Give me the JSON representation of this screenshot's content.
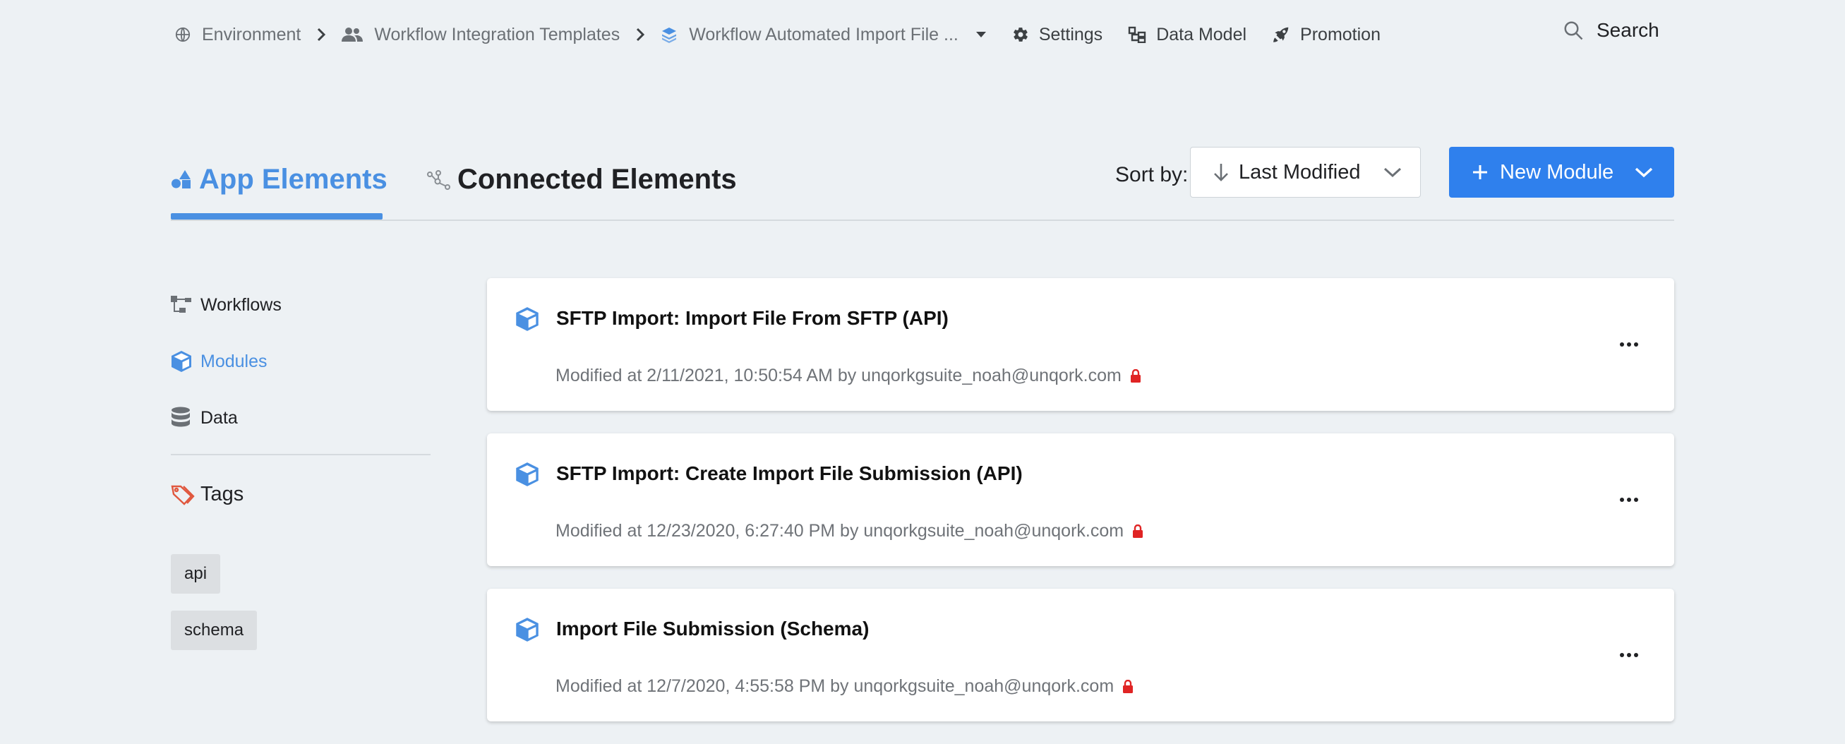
{
  "breadcrumb": {
    "environment": "Environment",
    "workspace": "Workflow Integration Templates",
    "app": "Workflow Automated Import File ..."
  },
  "nav": {
    "settings": "Settings",
    "data_model": "Data Model",
    "promotion": "Promotion",
    "search": "Search"
  },
  "tabs": {
    "app_elements": "App Elements",
    "connected_elements": "Connected Elements"
  },
  "sort": {
    "label": "Sort by:",
    "value": "Last Modified"
  },
  "new_module": {
    "label": "New Module"
  },
  "sidebar": {
    "items": [
      {
        "label": "Workflows",
        "active": false
      },
      {
        "label": "Modules",
        "active": true
      },
      {
        "label": "Data",
        "active": false
      }
    ],
    "tags_heading": "Tags",
    "tags": [
      "api",
      "schema"
    ]
  },
  "modules": [
    {
      "title": "SFTP Import: Import File From SFTP (API)",
      "meta": "Modified at 2/11/2021, 10:50:54 AM by unqorkgsuite_noah@unqork.com"
    },
    {
      "title": "SFTP Import: Create Import File Submission (API)",
      "meta": "Modified at 12/23/2020, 6:27:40 PM by unqorkgsuite_noah@unqork.com"
    },
    {
      "title": "Import File Submission (Schema)",
      "meta": "Modified at 12/7/2020, 4:55:58 PM by unqorkgsuite_noah@unqork.com"
    }
  ],
  "colors": {
    "accent": "#4a90e2",
    "primary_button": "#2f80ed",
    "lock": "#e02424",
    "tag_icon": "#e0573e"
  }
}
